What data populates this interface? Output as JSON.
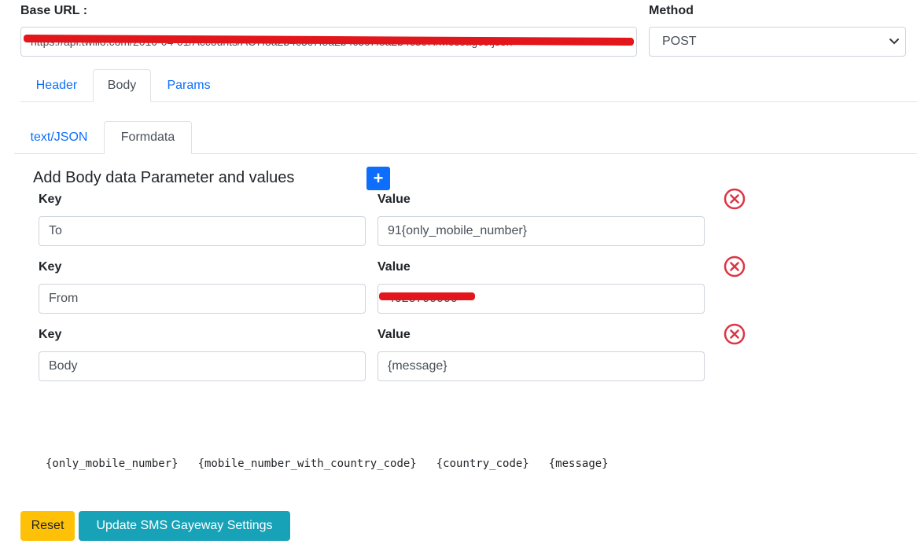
{
  "base_url": {
    "label": "Base URL :",
    "value": "https://api.twilio.com/2010-04-01/Accounts/AC7f8a2b4c3c7f8a2b4c3c7f8a2b4c3c7f/Messages.json"
  },
  "method": {
    "label": "Method",
    "value": "POST"
  },
  "main_tabs": [
    {
      "label": "Header"
    },
    {
      "label": "Body"
    },
    {
      "label": "Params"
    }
  ],
  "body_tabs": [
    {
      "label": "text/JSON"
    },
    {
      "label": "Formdata"
    }
  ],
  "section": {
    "title": "Add Body data Parameter and values",
    "add_label": "+"
  },
  "rows": [
    {
      "key_label": "Key",
      "value_label": "Value",
      "key": "To",
      "value": "91{only_mobile_number}"
    },
    {
      "key_label": "Key",
      "value_label": "Value",
      "key": "From",
      "value": "4025799999"
    },
    {
      "key_label": "Key",
      "value_label": "Value",
      "key": "Body",
      "value": "{message}"
    }
  ],
  "placeholders": [
    "{only_mobile_number}",
    "{mobile_number_with_country_code}",
    "{country_code}",
    "{message}"
  ],
  "buttons": {
    "reset": "Reset",
    "update": "Update SMS Gayeway Settings"
  },
  "colors": {
    "primary": "#0d6efd",
    "danger": "#dc3545",
    "warning": "#ffc107",
    "info": "#17a2b8",
    "redaction": "#e3161b"
  }
}
